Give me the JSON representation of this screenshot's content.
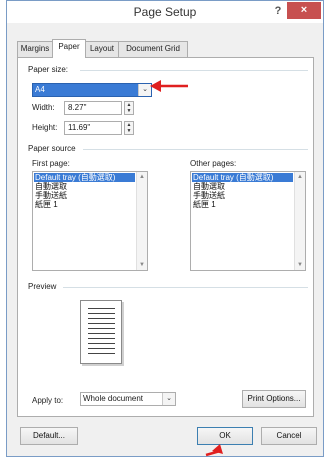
{
  "window": {
    "title": "Page Setup",
    "help_label": "?",
    "close_label": "×"
  },
  "tabs": [
    {
      "label": "Margins",
      "active": false
    },
    {
      "label": "Paper",
      "active": true
    },
    {
      "label": "Layout",
      "active": false
    },
    {
      "label": "Document Grid",
      "active": false
    }
  ],
  "paper_size": {
    "section_label": "Paper size:",
    "value": "A4",
    "width_label": "Width:",
    "width_value": "8.27\"",
    "height_label": "Height:",
    "height_value": "11.69\""
  },
  "paper_source": {
    "section_label": "Paper source",
    "first_page_label": "First page:",
    "first_page_items": [
      "Default tray (自動選取)",
      "自動選取",
      "手動送紙",
      "紙匣 1"
    ],
    "first_page_selected": "Default tray (自動選取)",
    "other_pages_label": "Other pages:",
    "other_pages_items": [
      "Default tray (自動選取)",
      "自動選取",
      "手動送紙",
      "紙匣 1"
    ],
    "other_pages_selected": "Default tray (自動選取)"
  },
  "preview": {
    "section_label": "Preview"
  },
  "apply_to": {
    "label": "Apply to:",
    "value": "Whole document"
  },
  "buttons": {
    "print_options": "Print Options...",
    "default": "Default...",
    "ok": "OK",
    "cancel": "Cancel"
  },
  "colors": {
    "annotation_arrow": "#e02020",
    "selection": "#3a7bd5",
    "close_button": "#c75050"
  },
  "icons": {
    "dropdown": "chevron-down-icon",
    "spin": "spin-arrows-icon",
    "annotation": "red-arrow-icon"
  }
}
